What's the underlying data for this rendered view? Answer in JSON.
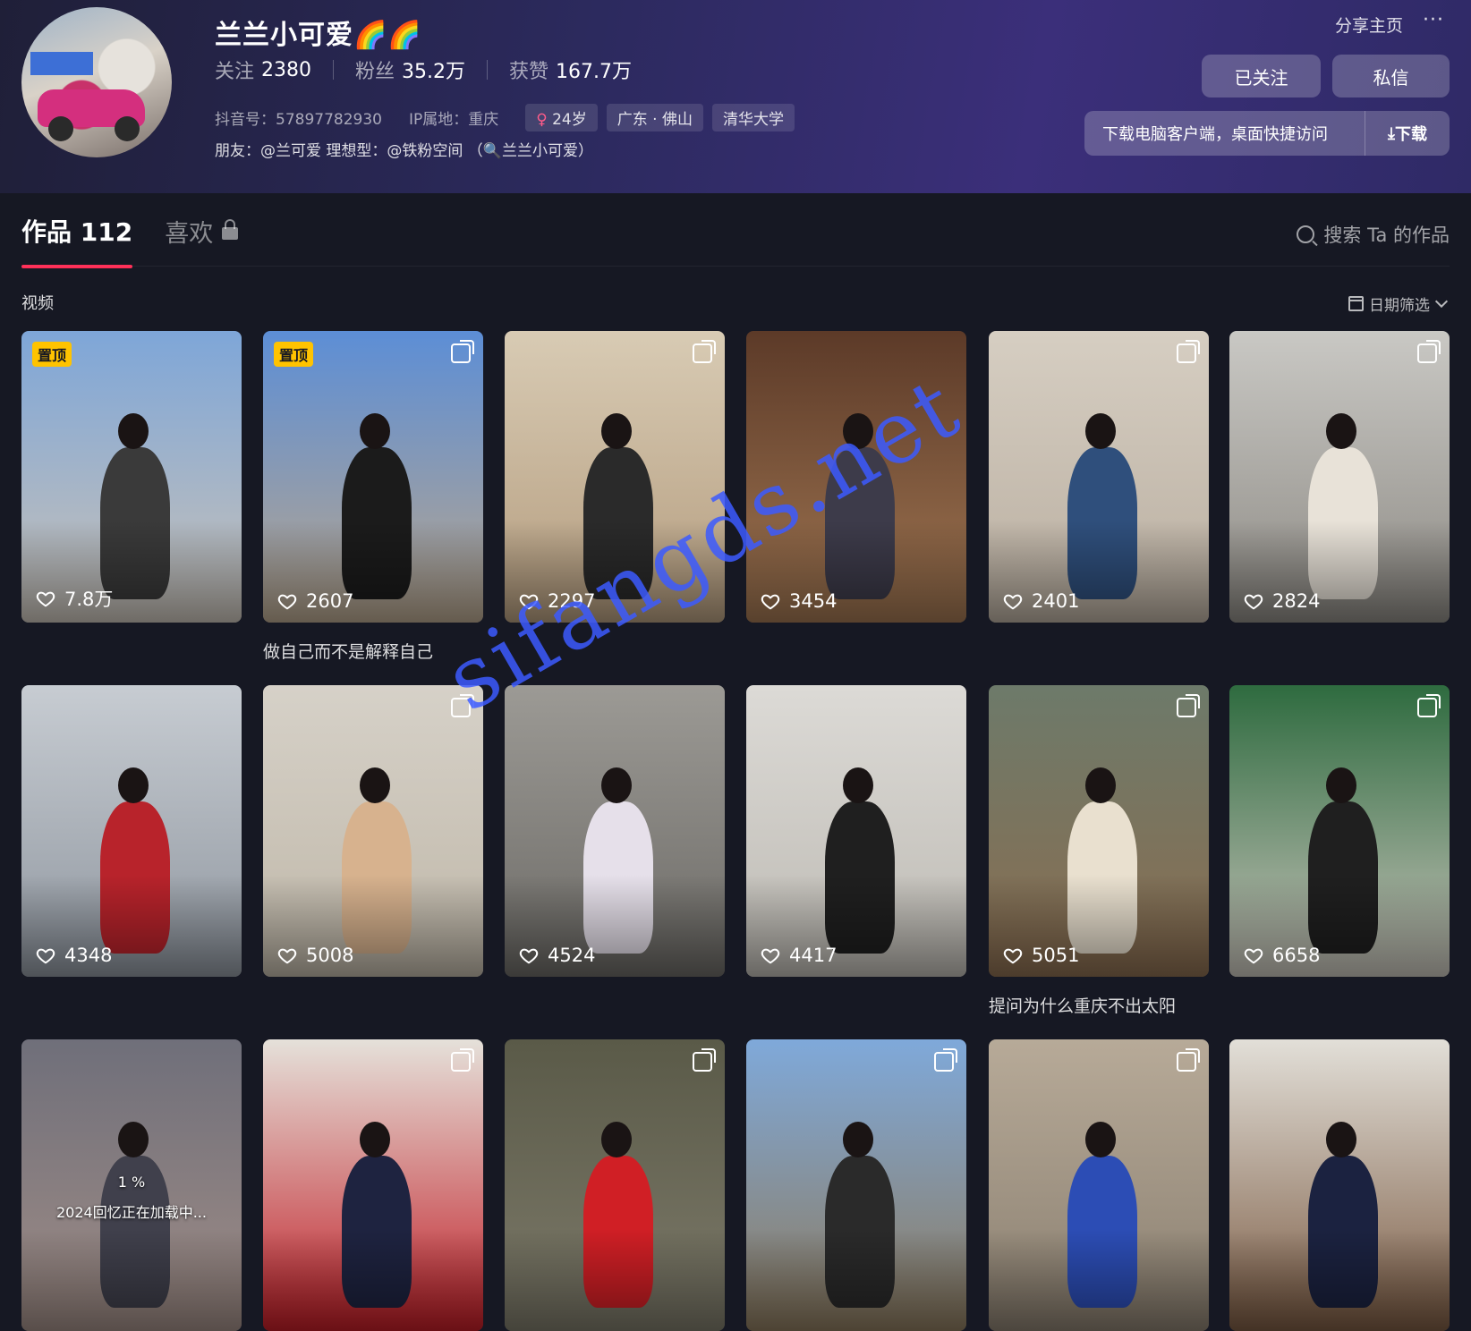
{
  "profile": {
    "name": "兰兰小可爱🌈🌈",
    "following_label": "关注",
    "following": "2380",
    "followers_label": "粉丝",
    "followers": "35.2万",
    "likes_label": "获赞",
    "likes": "167.7万",
    "douyin_id": "抖音号：57897782930",
    "ip": "IP属地：重庆",
    "tags": [
      "24岁",
      "广东 · 佛山",
      "清华大学"
    ],
    "friends": "朋友：@兰可爱  理想型：@铁粉空间  （🔍兰兰小可爱）"
  },
  "actions": {
    "share": "分享主页",
    "more": "···",
    "followed": "已关注",
    "message": "私信",
    "download_text": "下载电脑客户端，桌面快捷访问",
    "download_btn": "下载"
  },
  "tabs": {
    "works_label": "作品",
    "works_count": "112",
    "likes_label": "喜欢",
    "search_placeholder": "搜索 Ta 的作品"
  },
  "section": {
    "title": "视频",
    "filter": "日期筛选"
  },
  "videos": [
    {
      "likes": "7.8万",
      "pinned": "置顶",
      "colors": [
        "#7ea6d8",
        "#c9c2b8",
        "#3a3a3a"
      ]
    },
    {
      "likes": "2607",
      "pinned": "置顶",
      "multi": true,
      "caption": "做自己而不是解释自己",
      "colors": [
        "#5c8ed6",
        "#b8a68e",
        "#1b1b1b"
      ]
    },
    {
      "likes": "2297",
      "multi": true,
      "colors": [
        "#d8cbb4",
        "#b49c7e",
        "#2a2a2a"
      ]
    },
    {
      "likes": "3454",
      "colors": [
        "#5c3a28",
        "#a07652",
        "#3d3b4a"
      ]
    },
    {
      "likes": "2401",
      "multi": true,
      "colors": [
        "#d6cec2",
        "#b9aea0",
        "#2f4f7c"
      ]
    },
    {
      "likes": "2824",
      "multi": true,
      "colors": [
        "#c9c8c4",
        "#8d8a84",
        "#e8e2d8"
      ]
    },
    {
      "likes": "4348",
      "colors": [
        "#c7ccd2",
        "#8f969f",
        "#b8232b"
      ]
    },
    {
      "likes": "5008",
      "multi": true,
      "colors": [
        "#d6d1c8",
        "#bfb7a8",
        "#d7b28e"
      ]
    },
    {
      "likes": "4524",
      "colors": [
        "#9c9a95",
        "#6c6a66",
        "#e6e0ea"
      ]
    },
    {
      "likes": "4417",
      "colors": [
        "#dcdad6",
        "#bdbab3",
        "#1f1f1f"
      ]
    },
    {
      "likes": "5051",
      "multi": true,
      "caption": "提问为什么重庆不出太阳",
      "colors": [
        "#6d7a6a",
        "#8a6d50",
        "#e9e0cf"
      ]
    },
    {
      "likes": "6658",
      "multi": true,
      "colors": [
        "#2e6b3f",
        "#c8c4bb",
        "#1f1f1f"
      ]
    },
    {
      "likes": "",
      "loading_pct": "1 %",
      "loading_text": "2024回忆正在加载中...",
      "colors": [
        "#6f6f7a",
        "#a08d86",
        "#40404c"
      ]
    },
    {
      "likes": "",
      "multi": true,
      "colors": [
        "#e5e1da",
        "#c11d26",
        "#1e2340"
      ]
    },
    {
      "likes": "",
      "multi": true,
      "colors": [
        "#5a5a48",
        "#7d7a6a",
        "#d01f25"
      ]
    },
    {
      "likes": "",
      "multi": true,
      "colors": [
        "#7fa9da",
        "#8c7a5e",
        "#2a2a2a"
      ]
    },
    {
      "likes": "",
      "multi": true,
      "colors": [
        "#b7aa98",
        "#8a7f70",
        "#2c4db5"
      ]
    },
    {
      "likes": "",
      "colors": [
        "#e2dfd8",
        "#7b5b43",
        "#1b2240"
      ]
    }
  ],
  "watermark": "sifangds.net",
  "colors": {
    "accent": "#fe2c55",
    "pin": "#ffc300",
    "bg": "#161823"
  }
}
